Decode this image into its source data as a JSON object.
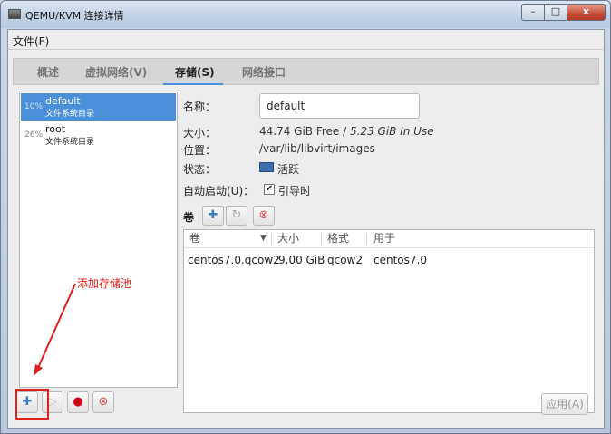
{
  "window": {
    "title": "QEMU/KVM 连接详情",
    "controls": {
      "minimize": "–",
      "maximize": "□",
      "close": "x"
    }
  },
  "menubar": {
    "file": "文件(F)"
  },
  "tabs": [
    {
      "label": "概述",
      "active": false
    },
    {
      "label": "虚拟网络(V)",
      "active": false
    },
    {
      "label": "存储(S)",
      "active": true
    },
    {
      "label": "网络接口",
      "active": false
    }
  ],
  "pools": [
    {
      "pct": "10%",
      "name": "default",
      "type": "文件系统目录",
      "selected": true
    },
    {
      "pct": "26%",
      "name": "root",
      "type": "文件系统目录",
      "selected": false
    }
  ],
  "details": {
    "name_label": "名称：",
    "name_value": "default",
    "size_label": "大小：",
    "size_free": "44.74 GiB Free / ",
    "size_inuse": "5.23 GiB In Use",
    "location_label": "位置：",
    "location_value": "/var/lib/libvirt/images",
    "state_label": "状态：",
    "state_value": "活跃",
    "autostart_label": "自动启动(U)：",
    "autostart_checkbox_label": "引导时",
    "autostart_checked": true
  },
  "volumes": {
    "toolbar_label": "卷",
    "columns": [
      "卷",
      "大小",
      "格式",
      "用于"
    ],
    "rows": [
      {
        "name": "centos7.0.qcow2",
        "size": "9.00 GiB",
        "format": "qcow2",
        "used_by": "centos7.0"
      }
    ]
  },
  "bottom": {
    "apply_label": "应用(A)"
  },
  "annotation": {
    "text": "添加存储池",
    "color": "#e0201a"
  },
  "colors": {
    "accent": "#4a90d9",
    "annotation_red": "#e0201a"
  }
}
